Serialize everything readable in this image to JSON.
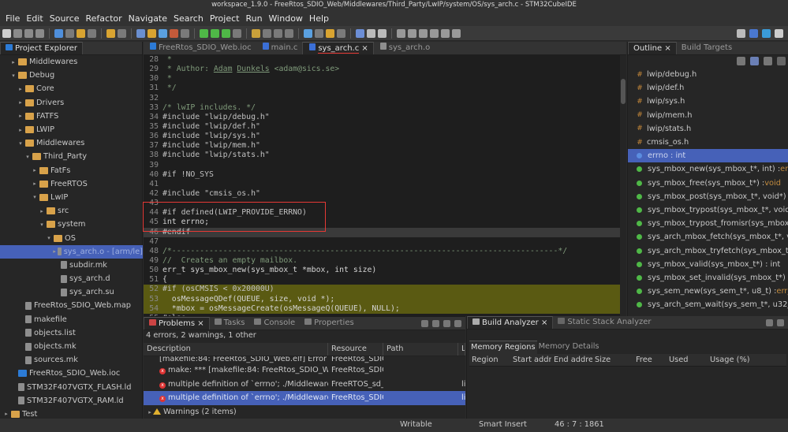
{
  "window": {
    "title": "workspace_1.9.0 - FreeRtos_SDIO_Web/Middlewares/Third_Party/LwIP/system/OS/sys_arch.c - STM32CubeIDE"
  },
  "menu": [
    "File",
    "Edit",
    "Source",
    "Refactor",
    "Navigate",
    "Search",
    "Project",
    "Run",
    "Window",
    "Help"
  ],
  "project_explorer": {
    "tab": "Project Explorer",
    "rows": [
      {
        "indent": 1,
        "arrow": "▸",
        "icon": "folder",
        "label": "Middlewares"
      },
      {
        "indent": 1,
        "arrow": "▾",
        "icon": "folder",
        "label": "Debug"
      },
      {
        "indent": 2,
        "arrow": "▸",
        "icon": "folder",
        "label": "Core"
      },
      {
        "indent": 2,
        "arrow": "▸",
        "icon": "folder",
        "label": "Drivers"
      },
      {
        "indent": 2,
        "arrow": "▸",
        "icon": "folder",
        "label": "FATFS"
      },
      {
        "indent": 2,
        "arrow": "▸",
        "icon": "folder",
        "label": "LWIP"
      },
      {
        "indent": 2,
        "arrow": "▾",
        "icon": "folder",
        "label": "Middlewares"
      },
      {
        "indent": 3,
        "arrow": "▾",
        "icon": "folder",
        "label": "Third_Party"
      },
      {
        "indent": 4,
        "arrow": "▸",
        "icon": "folder",
        "label": "FatFs"
      },
      {
        "indent": 4,
        "arrow": "▸",
        "icon": "folder",
        "label": "FreeRTOS"
      },
      {
        "indent": 4,
        "arrow": "▾",
        "icon": "folder",
        "label": "LwIP"
      },
      {
        "indent": 5,
        "arrow": "▸",
        "icon": "folder",
        "label": "src"
      },
      {
        "indent": 5,
        "arrow": "▾",
        "icon": "folder",
        "label": "system"
      },
      {
        "indent": 6,
        "arrow": "▾",
        "icon": "folder",
        "label": "OS"
      },
      {
        "indent": 7,
        "arrow": "▸",
        "icon": "file",
        "label": "sys_arch.o - [arm/le]",
        "selected": true
      },
      {
        "indent": 7,
        "arrow": "",
        "icon": "file",
        "label": "subdir.mk"
      },
      {
        "indent": 7,
        "arrow": "",
        "icon": "file",
        "label": "sys_arch.d"
      },
      {
        "indent": 7,
        "arrow": "",
        "icon": "file",
        "label": "sys_arch.su"
      },
      {
        "indent": 2,
        "arrow": "",
        "icon": "file",
        "label": "FreeRtos_SDIO_Web.map"
      },
      {
        "indent": 2,
        "arrow": "",
        "icon": "file",
        "label": "makefile"
      },
      {
        "indent": 2,
        "arrow": "",
        "icon": "file",
        "label": "objects.list"
      },
      {
        "indent": 2,
        "arrow": "",
        "icon": "file",
        "label": "objects.mk"
      },
      {
        "indent": 2,
        "arrow": "",
        "icon": "file",
        "label": "sources.mk"
      },
      {
        "indent": 1,
        "arrow": "",
        "icon": "proj",
        "label": "FreeRtos_SDIO_Web.ioc"
      },
      {
        "indent": 1,
        "arrow": "",
        "icon": "file",
        "label": "STM32F407VGTX_FLASH.ld"
      },
      {
        "indent": 1,
        "arrow": "",
        "icon": "file",
        "label": "STM32F407VGTX_RAM.ld"
      },
      {
        "indent": 0,
        "arrow": "▸",
        "icon": "folder",
        "label": "Test"
      }
    ]
  },
  "editor": {
    "tabs": [
      {
        "label": "FreeRtos_SDIO_Web.ioc",
        "active": false
      },
      {
        "label": "main.c",
        "active": false
      },
      {
        "label": "sys_arch.c",
        "active": true
      },
      {
        "label": "sys_arch.o",
        "active": false
      }
    ],
    "lines": [
      {
        "n": "28",
        "text": " *",
        "cls": "cm"
      },
      {
        "n": "29",
        "text": " * Author: Adam Dunkels <adam@sics.se>",
        "cls": "cm"
      },
      {
        "n": "30",
        "text": " *",
        "cls": "cm"
      },
      {
        "n": "31",
        "text": " */",
        "cls": "cm"
      },
      {
        "n": "32",
        "text": "",
        "cls": ""
      },
      {
        "n": "33",
        "text": "/* lwIP includes. */",
        "cls": "cm"
      },
      {
        "n": "34",
        "text": "#include \"lwip/debug.h\"",
        "cls": "inc"
      },
      {
        "n": "35",
        "text": "#include \"lwip/def.h\"",
        "cls": "inc"
      },
      {
        "n": "36",
        "text": "#include \"lwip/sys.h\"",
        "cls": "inc"
      },
      {
        "n": "37",
        "text": "#include \"lwip/mem.h\"",
        "cls": "inc"
      },
      {
        "n": "38",
        "text": "#include \"lwip/stats.h\"",
        "cls": "inc"
      },
      {
        "n": "39",
        "text": "",
        "cls": ""
      },
      {
        "n": "40",
        "text": "#if !NO_SYS",
        "cls": "pp"
      },
      {
        "n": "41",
        "text": "",
        "cls": ""
      },
      {
        "n": "42",
        "text": "#include \"cmsis_os.h\"",
        "cls": "inc"
      },
      {
        "n": "43",
        "text": "",
        "cls": ""
      },
      {
        "n": "44",
        "text": "#if defined(LWIP_PROVIDE_ERRNO)",
        "cls": "pp"
      },
      {
        "n": "45",
        "text": "int errno;",
        "cls": "ct"
      },
      {
        "n": "46",
        "text": "#endif",
        "cls": "pp",
        "row": "cur"
      },
      {
        "n": "47",
        "text": "",
        "cls": ""
      },
      {
        "n": "48",
        "text": "/*-----------------------------------------------------------------------------------*/",
        "cls": "cm"
      },
      {
        "n": "49",
        "text": "//  Creates an empty mailbox.",
        "cls": "cm"
      },
      {
        "n": "50",
        "text": "err_t sys_mbox_new(sys_mbox_t *mbox, int size)",
        "cls": "ct"
      },
      {
        "n": "51",
        "text": "{",
        "cls": "ct"
      },
      {
        "n": "52",
        "text": "#if (osCMSIS < 0x20000U)",
        "cls": "pp",
        "row": "hl"
      },
      {
        "n": "53",
        "text": "  osMessageQDef(QUEUE, size, void *);",
        "cls": "ct",
        "row": "hl"
      },
      {
        "n": "54",
        "text": "  *mbox = osMessageCreate(osMessageQ(QUEUE), NULL);",
        "cls": "ct",
        "row": "hl"
      },
      {
        "n": "55",
        "text": "#else",
        "cls": "pp"
      }
    ]
  },
  "outline": {
    "tabs": [
      {
        "label": "Outline",
        "active": true
      },
      {
        "label": "Build Targets",
        "active": false
      }
    ],
    "items": [
      {
        "kind": "inc",
        "name": "lwip/debug.h",
        "type": ""
      },
      {
        "kind": "inc",
        "name": "lwip/def.h",
        "type": ""
      },
      {
        "kind": "inc",
        "name": "lwip/sys.h",
        "type": ""
      },
      {
        "kind": "inc",
        "name": "lwip/mem.h",
        "type": ""
      },
      {
        "kind": "inc",
        "name": "lwip/stats.h",
        "type": ""
      },
      {
        "kind": "inc",
        "name": "cmsis_os.h",
        "type": ""
      },
      {
        "kind": "var",
        "name": "errno : int",
        "type": "",
        "selected": true
      },
      {
        "kind": "fn",
        "name": "sys_mbox_new(sys_mbox_t*, int) : ",
        "type": "err_t"
      },
      {
        "kind": "fn",
        "name": "sys_mbox_free(sys_mbox_t*) : ",
        "type": "void"
      },
      {
        "kind": "fn",
        "name": "sys_mbox_post(sys_mbox_t*, void*) : ",
        "type": "void"
      },
      {
        "kind": "fn",
        "name": "sys_mbox_trypost(sys_mbox_t*, void*) : ",
        "type": "e"
      },
      {
        "kind": "fn",
        "name": "sys_mbox_trypost_fromisr(sys_mbox_t*, vo",
        "type": ""
      },
      {
        "kind": "fn",
        "name": "sys_arch_mbox_fetch(sys_mbox_t*, void**",
        "type": ""
      },
      {
        "kind": "fn",
        "name": "sys_arch_mbox_tryfetch(sys_mbox_t*, voi",
        "type": ""
      },
      {
        "kind": "fn",
        "name": "sys_mbox_valid(sys_mbox_t*) : int",
        "type": ""
      },
      {
        "kind": "fn",
        "name": "sys_mbox_set_invalid(sys_mbox_t*) : ",
        "type": "void"
      },
      {
        "kind": "fn",
        "name": "sys_sem_new(sys_sem_t*, u8_t) : ",
        "type": "err_t"
      },
      {
        "kind": "fn",
        "name": "sys_arch_sem_wait(sys_sem_t*, u32_t) : ",
        "type": "u"
      }
    ]
  },
  "problems": {
    "tabs": [
      "Problems",
      "Tasks",
      "Console",
      "Properties"
    ],
    "summary": "4 errors, 2 warnings, 1 other",
    "columns": [
      "Description",
      "Resource",
      "Path",
      "L"
    ],
    "rows": [
      {
        "icon": "",
        "desc": "[makefile:84: FreeRtos_SDIO_Web.elf] Error 1",
        "res": "FreeRtos_SDIO_",
        "path": "",
        "selected": false
      },
      {
        "icon": "err",
        "desc": "make: *** [makefile:84: FreeRtos_SDIO_Web.elf] Error 1",
        "res": "FreeRtos_SDIO_",
        "path": "",
        "selected": false
      },
      {
        "icon": "err",
        "desc": "multiple definition of `errno'; ./Middlewares/Third_Party",
        "res": "FreeRTOS_sd_w",
        "path": "",
        "l": "li",
        "selected": false
      },
      {
        "icon": "err",
        "desc": "multiple definition of `errno'; ./Middlewares/Third_Party",
        "res": "FreeRtos_SDIO_",
        "path": "",
        "l": "li",
        "selected": true
      }
    ],
    "warnings": "Warnings (2 items)"
  },
  "build": {
    "tabs": [
      "Build Analyzer",
      "Static Stack Analyzer"
    ],
    "subtabs": [
      "Memory Regions",
      "Memory Details"
    ],
    "columns": [
      "Region",
      "Start addre",
      "End addres",
      "Size",
      "Free",
      "Used",
      "Usage (%)"
    ]
  },
  "status": {
    "writable": "Writable",
    "insert": "Smart Insert",
    "position": "46 : 7 : 1861"
  }
}
